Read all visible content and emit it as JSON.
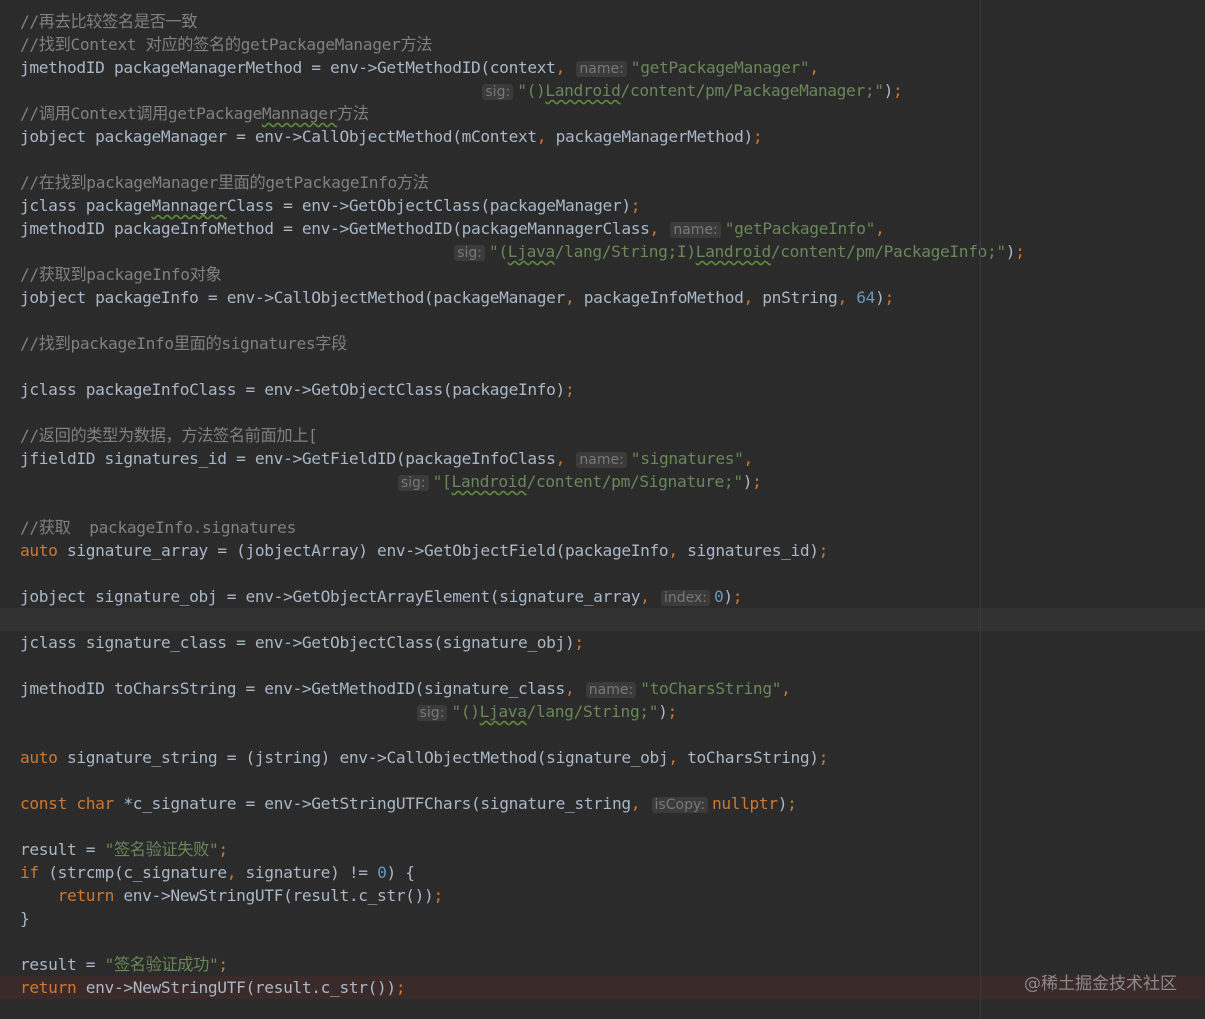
{
  "editor": {
    "current_line": 26,
    "error_line": 42,
    "lines": [
      [
        [
          "cm",
          "//再去比较签名是否一致"
        ]
      ],
      [
        [
          "cm",
          "//找到Context 对应的签名的getPackageManager方法"
        ]
      ],
      [
        [
          "t",
          "jmethodID packageManagerMethod = env->GetMethodID(context, "
        ],
        [
          "hint",
          "name:"
        ],
        [
          "str",
          "\"getPackageManager\""
        ],
        [
          "t",
          ","
        ]
      ],
      [
        [
          "t",
          "                                                 "
        ],
        [
          "hint",
          "sig:"
        ],
        [
          "str",
          "\"()"
        ],
        [
          "strtypo",
          "Landroid"
        ],
        [
          "str",
          "/content/pm/PackageManager;\""
        ],
        [
          "t",
          ");"
        ]
      ],
      [
        [
          "cm",
          "//调用Context调用getPackage"
        ],
        [
          "cmtypo",
          "Mannager"
        ],
        [
          "cm",
          "方法"
        ]
      ],
      [
        [
          "t",
          "jobject packageManager = env->CallObjectMethod(mContext, packageManagerMethod);"
        ]
      ],
      [],
      [
        [
          "cm",
          "//在找到packageManager里面的getPackageInfo方法"
        ]
      ],
      [
        [
          "t",
          "jclass package"
        ],
        [
          "typo",
          "Mannager"
        ],
        [
          "t",
          "Class = env->GetObjectClass(packageManager);"
        ]
      ],
      [
        [
          "t",
          "jmethodID packageInfoMethod = env->GetMethodID(packageMannagerClass, "
        ],
        [
          "hint",
          "name:"
        ],
        [
          "str",
          "\"getPackageInfo\""
        ],
        [
          "t",
          ","
        ]
      ],
      [
        [
          "t",
          "                                              "
        ],
        [
          "hint",
          "sig:"
        ],
        [
          "str",
          "\"("
        ],
        [
          "strtypo",
          "Ljava"
        ],
        [
          "str",
          "/lang/String;I)"
        ],
        [
          "strtypo",
          "Landroid"
        ],
        [
          "str",
          "/content/pm/PackageInfo;\""
        ],
        [
          "t",
          ");"
        ]
      ],
      [
        [
          "cm",
          "//获取到packageInfo对象"
        ]
      ],
      [
        [
          "t",
          "jobject packageInfo = env->CallObjectMethod(packageManager, packageInfoMethod, pnString, "
        ],
        [
          "num",
          "64"
        ],
        [
          "t",
          ");"
        ]
      ],
      [],
      [
        [
          "cm",
          "//找到packageInfo里面的signatures字段"
        ]
      ],
      [],
      [
        [
          "t",
          "jclass packageInfoClass = env->GetObjectClass(packageInfo);"
        ]
      ],
      [],
      [
        [
          "cm",
          "//返回的类型为数据，方法签名前面加上["
        ]
      ],
      [
        [
          "t",
          "jfieldID signatures_id = env->GetFieldID(packageInfoClass, "
        ],
        [
          "hint",
          "name:"
        ],
        [
          "str",
          "\"signatures\""
        ],
        [
          "t",
          ","
        ]
      ],
      [
        [
          "t",
          "                                        "
        ],
        [
          "hint",
          "sig:"
        ],
        [
          "str",
          "\"["
        ],
        [
          "strtypo",
          "Landroid"
        ],
        [
          "str",
          "/content/pm/Signature;\""
        ],
        [
          "t",
          ");"
        ]
      ],
      [],
      [
        [
          "cm",
          "//获取  packageInfo.signatures"
        ]
      ],
      [
        [
          "kw",
          "auto"
        ],
        [
          "t",
          " signature_array = (jobjectArray) env->GetObjectField(packageInfo, signatures_id);"
        ]
      ],
      [],
      [
        [
          "t",
          "jobject signature_obj = env->GetObjectArrayElement(signature_array, "
        ],
        [
          "hint",
          "index:"
        ],
        [
          "num",
          "0"
        ],
        [
          "t",
          ");"
        ]
      ],
      [],
      [
        [
          "t",
          "jclass signature_class = env->GetObjectClass(signature_obj);"
        ]
      ],
      [],
      [
        [
          "t",
          "jmethodID toCharsString = env->GetMethodID(signature_class, "
        ],
        [
          "hint",
          "name:"
        ],
        [
          "str",
          "\"toCharsString\""
        ],
        [
          "t",
          ","
        ]
      ],
      [
        [
          "t",
          "                                          "
        ],
        [
          "hint",
          "sig:"
        ],
        [
          "str",
          "\"()"
        ],
        [
          "strtypo",
          "Ljava"
        ],
        [
          "str",
          "/lang/String;\""
        ],
        [
          "t",
          ");"
        ]
      ],
      [],
      [
        [
          "kw",
          "auto"
        ],
        [
          "t",
          " signature_string = (jstring) env->CallObjectMethod(signature_obj, toCharsString);"
        ]
      ],
      [],
      [
        [
          "kw",
          "const char"
        ],
        [
          "t",
          " *c_signature = env->GetStringUTFChars(signature_string, "
        ],
        [
          "hint",
          "isCopy:"
        ],
        [
          "kw",
          "nullptr"
        ],
        [
          "t",
          ");"
        ]
      ],
      [],
      [
        [
          "t",
          "result = "
        ],
        [
          "str",
          "\"签名验证失败\""
        ],
        [
          "t",
          ";"
        ]
      ],
      [
        [
          "kw",
          "if"
        ],
        [
          "t",
          " (strcmp(c_signature, signature) != "
        ],
        [
          "num",
          "0"
        ],
        [
          "t",
          ") {"
        ]
      ],
      [
        [
          "t",
          "    "
        ],
        [
          "kw",
          "return"
        ],
        [
          "t",
          " env->NewStringUTF(result.c_str());"
        ]
      ],
      [
        [
          "t",
          "}"
        ]
      ],
      [],
      [
        [
          "t",
          "result = "
        ],
        [
          "str",
          "\"签名验证成功\""
        ],
        [
          "t",
          ";"
        ]
      ],
      [
        [
          "kw",
          "return"
        ],
        [
          "t",
          " env->NewStringUTF(result.c_str());"
        ]
      ]
    ]
  },
  "watermark": "@稀土掘金技术社区"
}
